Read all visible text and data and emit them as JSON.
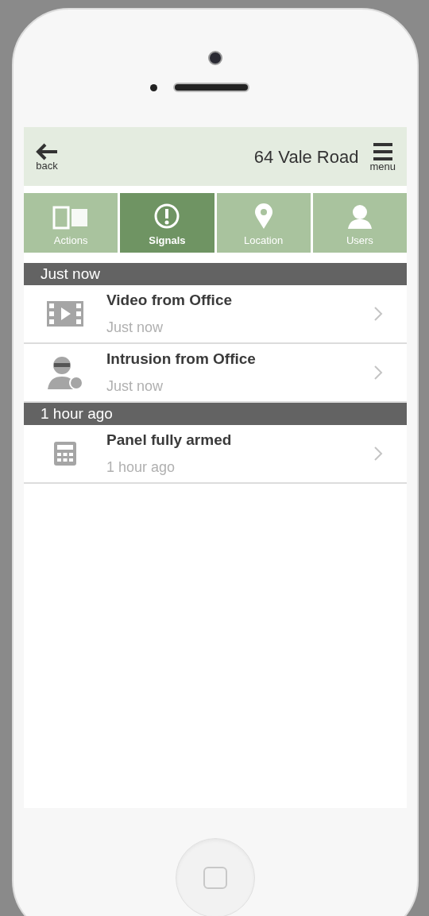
{
  "header": {
    "back_label": "back",
    "title": "64 Vale Road",
    "menu_label": "menu"
  },
  "tabs": [
    {
      "kind": "actions",
      "label": "Actions",
      "selected": false
    },
    {
      "kind": "signals",
      "label": "Signals",
      "selected": true
    },
    {
      "kind": "location",
      "label": "Location",
      "selected": false
    },
    {
      "kind": "users",
      "label": "Users",
      "selected": false
    }
  ],
  "sections": [
    {
      "heading": "Just now",
      "items": [
        {
          "kind": "video",
          "title": "Video from Office",
          "time": "Just now"
        },
        {
          "kind": "intrusion",
          "title": "Intrusion from Office",
          "time": "Just now"
        }
      ]
    },
    {
      "heading": "1 hour ago",
      "items": [
        {
          "kind": "panel",
          "title": "Panel fully armed",
          "time": "1 hour ago"
        }
      ]
    }
  ]
}
